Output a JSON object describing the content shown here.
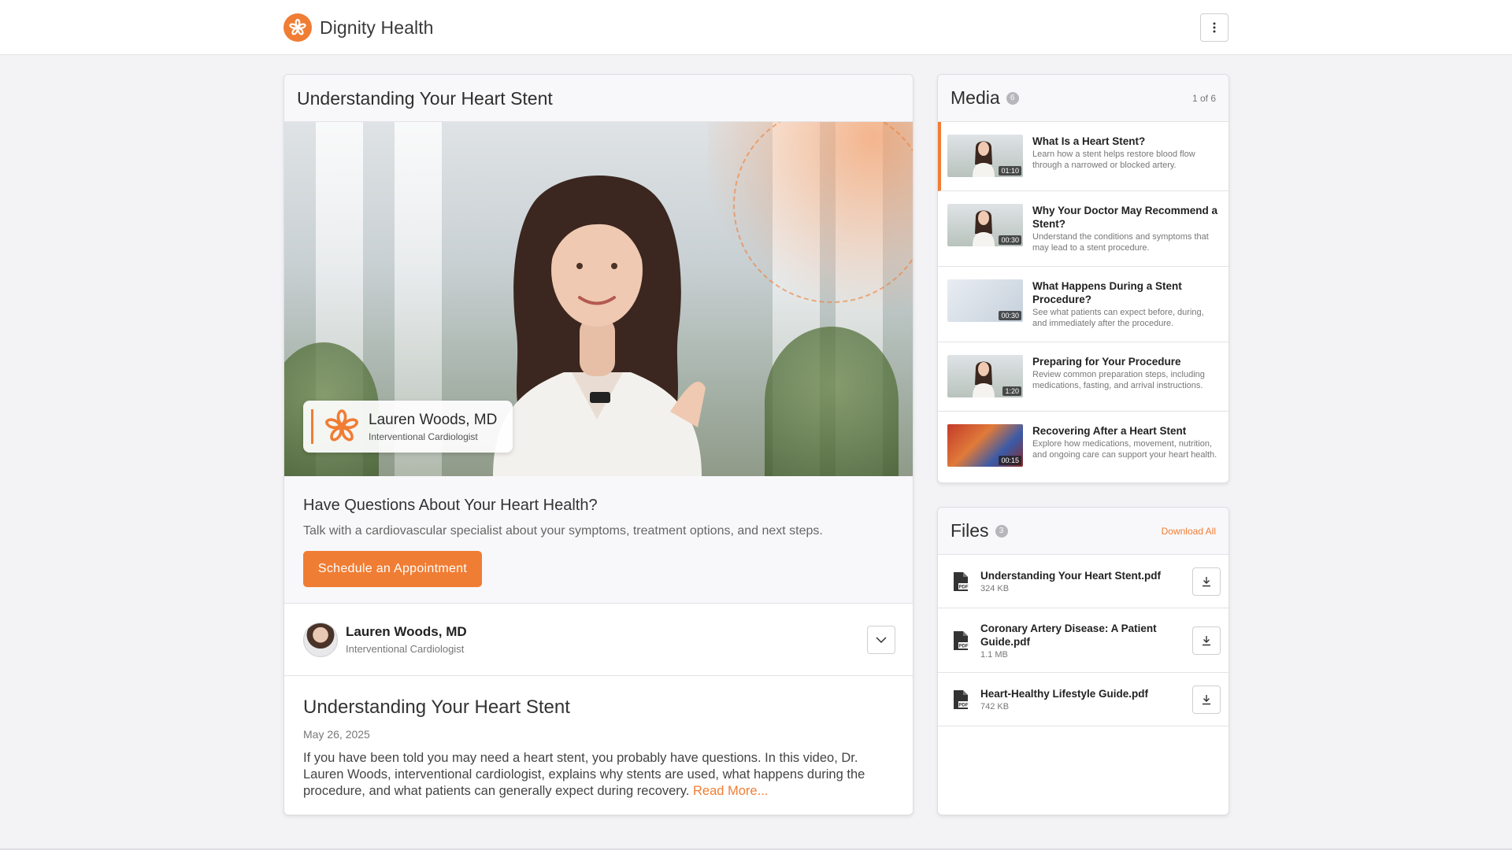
{
  "brand": {
    "name": "Dignity Health",
    "accent_color": "#f07d34"
  },
  "header": {
    "menu_icon": "more-vertical-icon"
  },
  "main": {
    "title": "Understanding Your Heart Stent",
    "video": {
      "presenter_name": "Lauren Woods, MD",
      "presenter_title": "Interventional Cardiologist"
    },
    "cta": {
      "heading": "Have Questions About Your Heart Health?",
      "text": "Talk with a cardiovascular specialist about your symptoms, treatment options, and next steps.",
      "button_label": "Schedule an Appointment"
    },
    "author": {
      "name": "Lauren Woods,  MD",
      "title": "Interventional Cardiologist",
      "expand_icon": "chevron-down-icon"
    },
    "description": {
      "title": "Understanding Your Heart Stent",
      "date": "May 26, 2025",
      "body": "If you have been told you may need a heart stent, you probably have questions. In this video, Dr. Lauren Woods, interventional cardiologist, explains why stents are used, what happens during the procedure, and what patients can generally expect during recovery. ",
      "read_more": "Read More..."
    }
  },
  "media": {
    "title": "Media",
    "count": "6",
    "position": "1 of 6",
    "items": [
      {
        "title": "What Is a Heart Stent?",
        "description": "Learn how a stent helps restore blood flow through a narrowed or blocked artery.",
        "duration": "01:10",
        "active": true
      },
      {
        "title": "Why Your Doctor May Recommend a Stent?",
        "description": "Understand the conditions and symptoms that may lead to a stent procedure.",
        "duration": "00:30",
        "active": false
      },
      {
        "title": "What Happens During a Stent Procedure?",
        "description": "See what patients can expect before, during, and immediately after the procedure.",
        "duration": "00:30",
        "active": false
      },
      {
        "title": "Preparing for Your Procedure",
        "description": "Review common preparation steps, including medications, fasting, and arrival instructions.",
        "duration": "1:20",
        "active": false
      },
      {
        "title": "Recovering After a Heart Stent",
        "description": "Explore how medications, movement, nutrition, and ongoing care can support your heart health.",
        "duration": "00:15",
        "active": false
      }
    ]
  },
  "files": {
    "title": "Files",
    "count": "3",
    "download_all": "Download All",
    "items": [
      {
        "name": "Understanding Your Heart Stent.pdf",
        "size": "324 KB",
        "icon": "pdf-file-icon"
      },
      {
        "name": "Coronary Artery Disease: A Patient Guide.pdf",
        "size": "1.1 MB",
        "icon": "pdf-file-icon"
      },
      {
        "name": "Heart-Healthy Lifestyle Guide.pdf",
        "size": "742 KB",
        "icon": "pdf-file-icon"
      }
    ]
  }
}
